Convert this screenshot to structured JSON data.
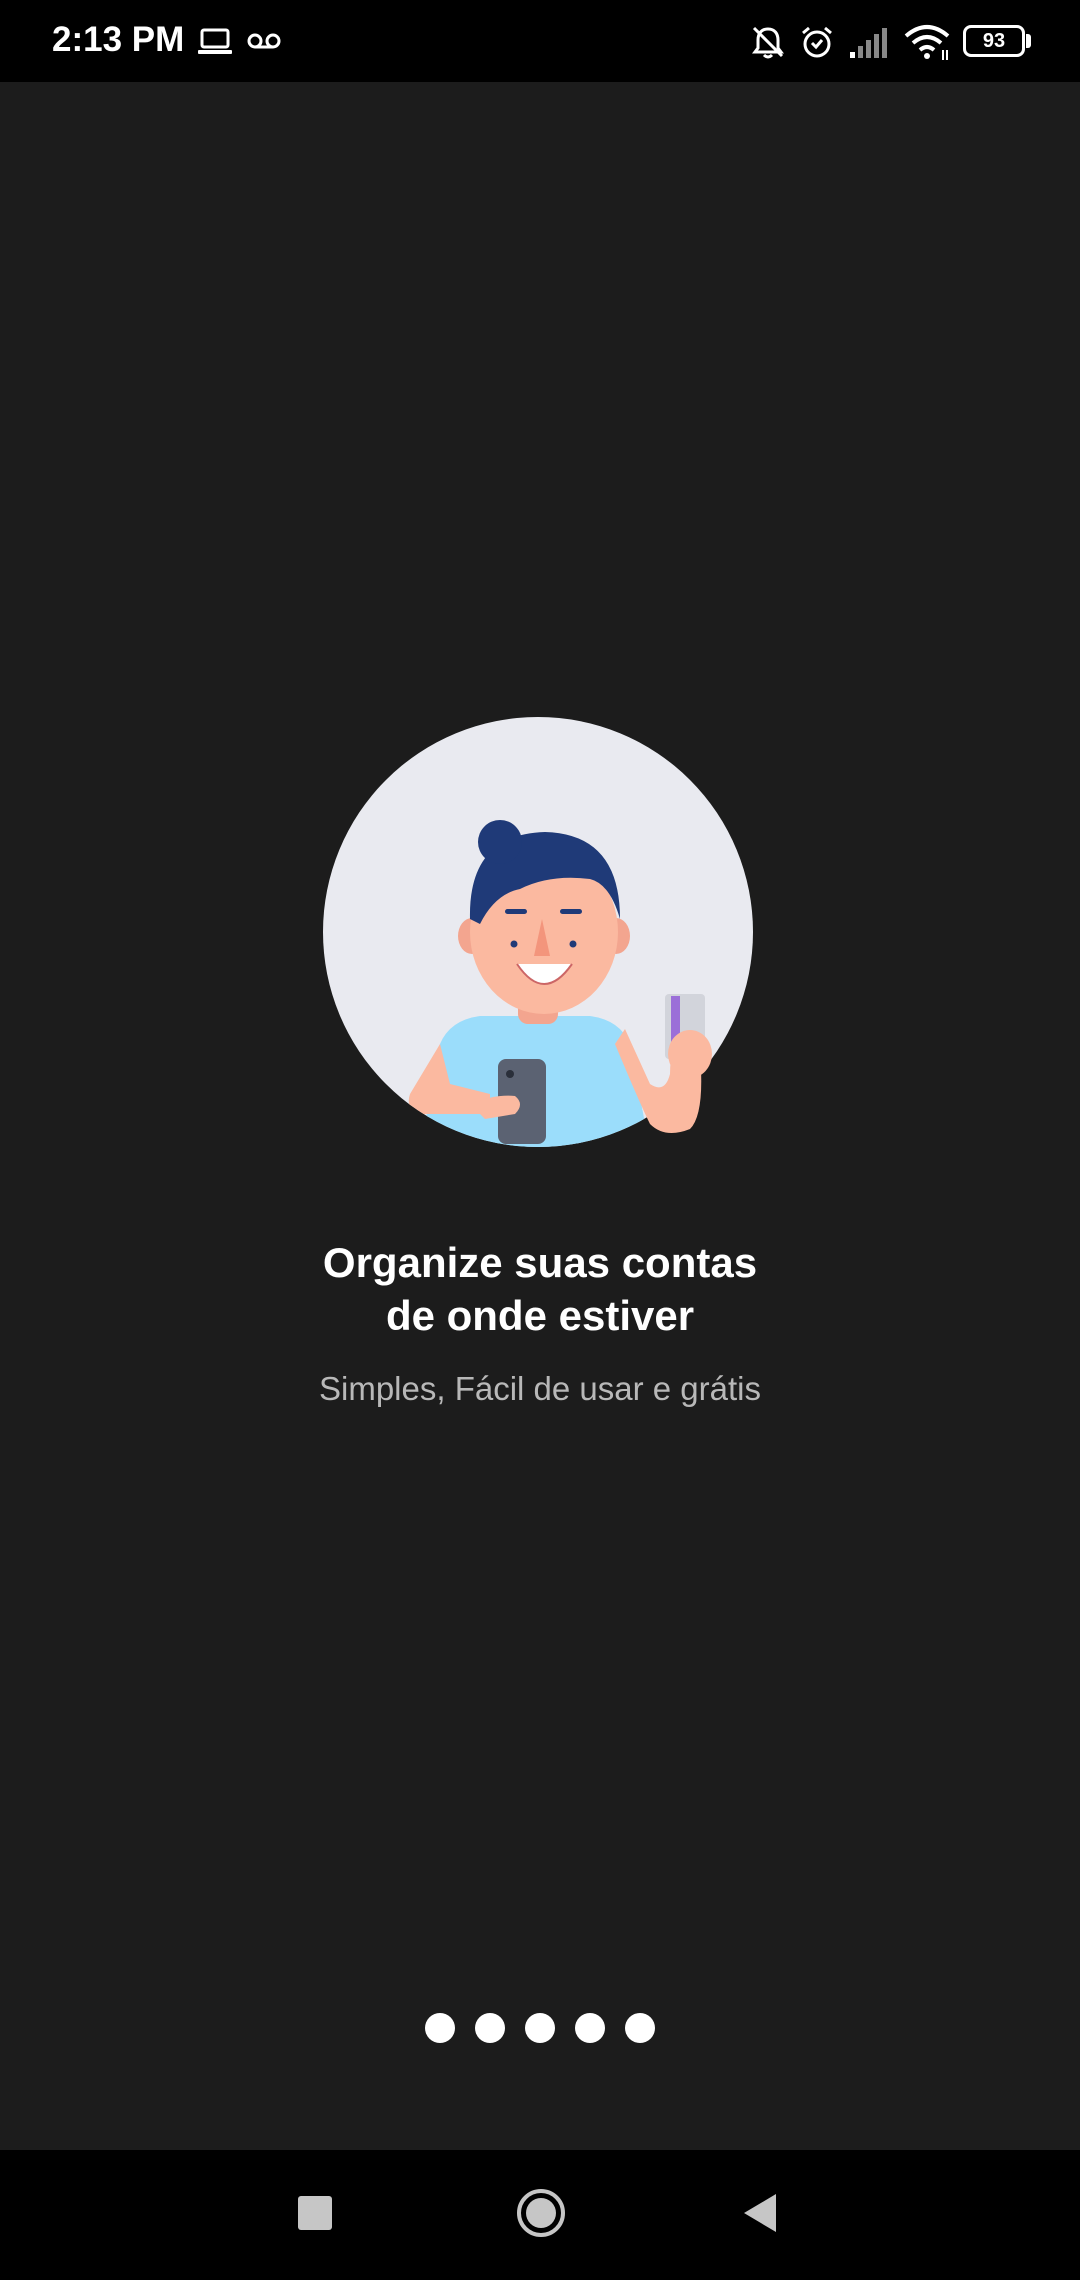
{
  "status_bar": {
    "time": "2:13 PM",
    "battery_level": "93",
    "icons": [
      "laptop-icon",
      "voicemail-icon",
      "bell-off-icon",
      "alarm-icon",
      "signal-icon",
      "wifi-icon",
      "battery-icon"
    ]
  },
  "onboarding": {
    "illustration": "man-with-phone-and-card-illustration",
    "title_line1": "Organize suas contas",
    "title_line2": "de onde estiver",
    "subtitle": "Simples, Fácil de usar e grátis",
    "page_dots": 5
  },
  "nav_bar": {
    "buttons": [
      "recents-square-icon",
      "home-circle-icon",
      "back-triangle-icon"
    ]
  },
  "colors": {
    "background": "#1c1c1c",
    "circle_bg": "#e9eaf0",
    "hair": "#1f3a78",
    "shirt": "#9bddfb",
    "skin": "#fbb9a0"
  }
}
